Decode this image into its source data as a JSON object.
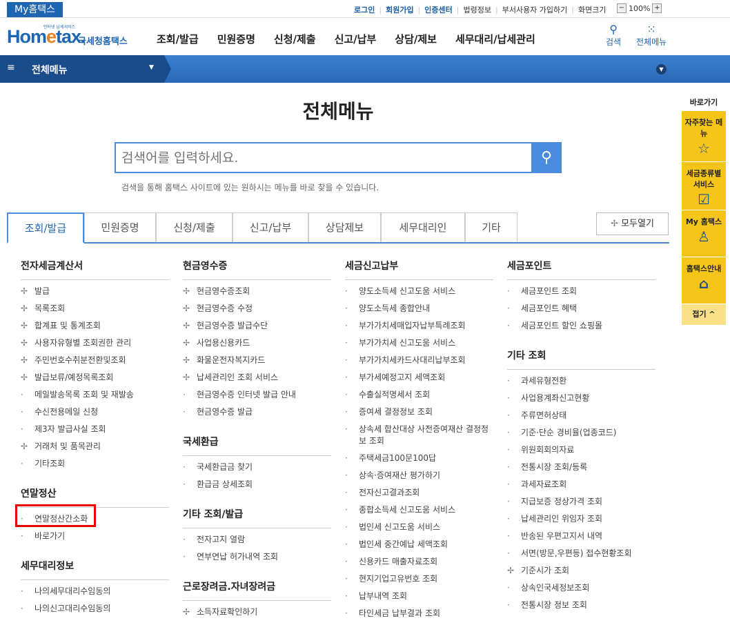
{
  "topbar": {
    "myhome": "My홈택스",
    "links": [
      "로그인",
      "회원가입",
      "인증센터",
      "법령정보",
      "부서사용자 가입하기",
      "화면크기"
    ],
    "zoom": "100%"
  },
  "logo": {
    "main_a": "Hom",
    "main_e": "e",
    "main_b": "tax.",
    "tagline": "인터넷 납세서비스",
    "korean": "국세청홈택스"
  },
  "gnb": [
    "조회/발급",
    "민원증명",
    "신청/제출",
    "신고/납부",
    "상담/제보",
    "세무대리/납세관리"
  ],
  "header_icons": {
    "search": "검색",
    "all_menu": "전체메뉴"
  },
  "menubar": {
    "label": "전체메뉴"
  },
  "page_title": "전체메뉴",
  "search": {
    "placeholder": "검색어를 입력하세요.",
    "help": "검색을 통해 홈택스 사이트에 있는 원하시는 메뉴를 바로 찾을 수 있습니다."
  },
  "tabs": [
    "조회/발급",
    "민원증명",
    "신청/제출",
    "신고/납부",
    "상담제보",
    "세무대리인",
    "기타"
  ],
  "open_all": "모두열기",
  "columns": [
    [
      {
        "title": "전자세금계산서",
        "items": [
          [
            "✢",
            "발급"
          ],
          [
            "✢",
            "목록조회"
          ],
          [
            "✢",
            "합계표 및 통계조회"
          ],
          [
            "✢",
            "사용자유형별 조회권한 관리"
          ],
          [
            "✢",
            "주민번호수취분전환및조회"
          ],
          [
            "✢",
            "발급보류/예정목록조회"
          ],
          [
            "·",
            "메일발송목록 조회 및 재발송"
          ],
          [
            "·",
            "수신전용메일 신청"
          ],
          [
            "·",
            "제3자 발급사실 조회"
          ],
          [
            "✢",
            "거래처 및 품목관리"
          ],
          [
            "·",
            "기타조회"
          ]
        ]
      },
      {
        "title": "연말정산",
        "items": [
          [
            "·",
            "연말정산간소화"
          ],
          [
            "·",
            "바로가기"
          ]
        ]
      },
      {
        "title": "세무대리정보",
        "items": [
          [
            "·",
            "나의세무대리수임동의"
          ],
          [
            "·",
            "나의신고대리수임동의"
          ]
        ]
      }
    ],
    [
      {
        "title": "현금영수증",
        "items": [
          [
            "✢",
            "현금영수증조회"
          ],
          [
            "✢",
            "현금영수증 수정"
          ],
          [
            "✢",
            "현금영수증 발급수단"
          ],
          [
            "✢",
            "사업용신용카드"
          ],
          [
            "✢",
            "화물운전자복지카드"
          ],
          [
            "✢",
            "납세관리인 조회 서비스"
          ],
          [
            "·",
            "현금영수증 인터넷 발급 안내"
          ],
          [
            "·",
            "현금영수증 발급"
          ]
        ]
      },
      {
        "title": "국세환급",
        "items": [
          [
            "·",
            "국세환급금 찾기"
          ],
          [
            "·",
            "환급금 상세조회"
          ]
        ]
      },
      {
        "title": "기타 조회/발급",
        "items": [
          [
            "·",
            "전자고지 열람"
          ],
          [
            "·",
            "연부연납 허가내역 조회"
          ]
        ]
      },
      {
        "title": "근로장려금.자녀장려금",
        "items": [
          [
            "✢",
            "소득자료확인하기"
          ]
        ]
      }
    ],
    [
      {
        "title": "세금신고납부",
        "items": [
          [
            "·",
            "양도소득세 신고도움 서비스"
          ],
          [
            "·",
            "양도소득세 종합안내"
          ],
          [
            "·",
            "부가가치세매입자납부특례조회"
          ],
          [
            "·",
            "부가가치세 신고도움 서비스"
          ],
          [
            "·",
            "부가가치세카드사대리납부조회"
          ],
          [
            "·",
            "부가세예정고지 세액조회"
          ],
          [
            "·",
            "수출실적명세서 조회"
          ],
          [
            "·",
            "증여세 결정정보 조회"
          ],
          [
            "·",
            "상속세 합산대상 사전증여재산 결정정보 조회"
          ],
          [
            "·",
            "주택세금100문100답"
          ],
          [
            "·",
            "상속·증여재산 평가하기"
          ],
          [
            "·",
            "전자신고결과조회"
          ],
          [
            "·",
            "종합소득세 신고도움 서비스"
          ],
          [
            "·",
            "법인세 신고도움 서비스"
          ],
          [
            "·",
            "법인세 중간예납 세액조회"
          ],
          [
            "·",
            "신용카드 매출자료조회"
          ],
          [
            "·",
            "현지기업고유번호 조회"
          ],
          [
            "·",
            "납부내역 조회"
          ],
          [
            "·",
            "타인세금 납부결과 조회"
          ]
        ]
      }
    ],
    [
      {
        "title": "세금포인트",
        "items": [
          [
            "·",
            "세금포인트 조회"
          ],
          [
            "·",
            "세금포인트 혜택"
          ],
          [
            "·",
            "세금포인트 할인 쇼핑몰"
          ]
        ]
      },
      {
        "title": "기타 조회",
        "items": [
          [
            "·",
            "과세유형전환"
          ],
          [
            "·",
            "사업용계좌신고현황"
          ],
          [
            "·",
            "주류면허상태"
          ],
          [
            "·",
            "기준·단순 경비율(업종코드)"
          ],
          [
            "·",
            "위원회회의자료"
          ],
          [
            "·",
            "전통시장 조회/등록"
          ],
          [
            "·",
            "과세자료조회"
          ],
          [
            "·",
            "지급보증 정상가격 조회"
          ],
          [
            "·",
            "납세관리인 위임자 조회"
          ],
          [
            "·",
            "반송된 우편고지서 내역"
          ],
          [
            "·",
            "서면(방문,우편등) 접수현황조회"
          ],
          [
            "✢",
            "기준시가 조회"
          ],
          [
            "·",
            "상속인국세정보조회"
          ],
          [
            "·",
            "전통시장 정보 조회"
          ]
        ]
      }
    ]
  ],
  "quick": {
    "header": "바로가기",
    "items": [
      "자주찾는 메뉴",
      "세금종류별 서비스",
      "My 홈택스",
      "홈택스안내"
    ],
    "close": "접기"
  }
}
